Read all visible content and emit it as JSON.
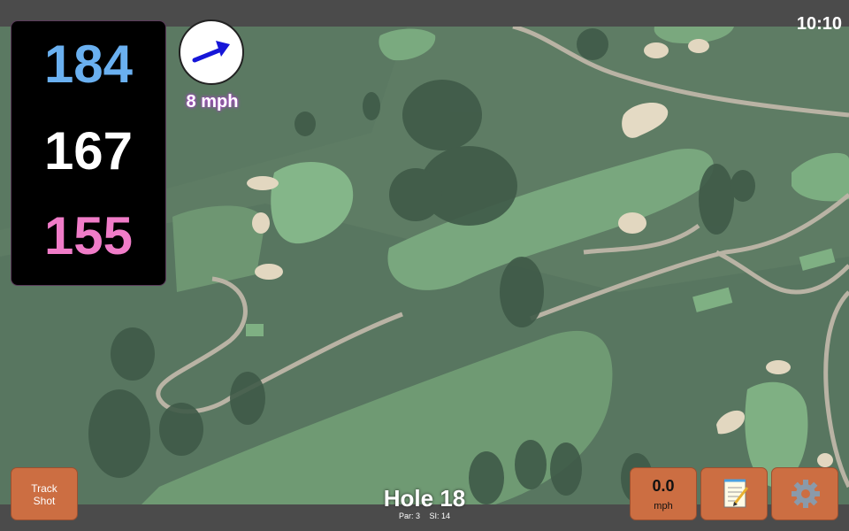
{
  "status_bar": {
    "time": "10:10"
  },
  "distances": {
    "back": "184",
    "middle": "167",
    "front": "155"
  },
  "wind": {
    "speed": "8 mph"
  },
  "hole": {
    "title": "Hole 18",
    "par": "Par: 3",
    "si": "SI: 14"
  },
  "buttons": {
    "track_line1": "Track",
    "track_line2": "Shot",
    "speed_value": "0.0",
    "speed_unit": "mph"
  },
  "icons": {
    "wind": "wind-arrow-icon",
    "notes": "notepad-icon",
    "settings": "gear-icon"
  },
  "colors": {
    "back_distance": "#6ab0f0",
    "middle_distance": "#ffffff",
    "front_distance": "#f07cc8",
    "button": "#cc6e42",
    "bar": "#4b4b4b"
  }
}
